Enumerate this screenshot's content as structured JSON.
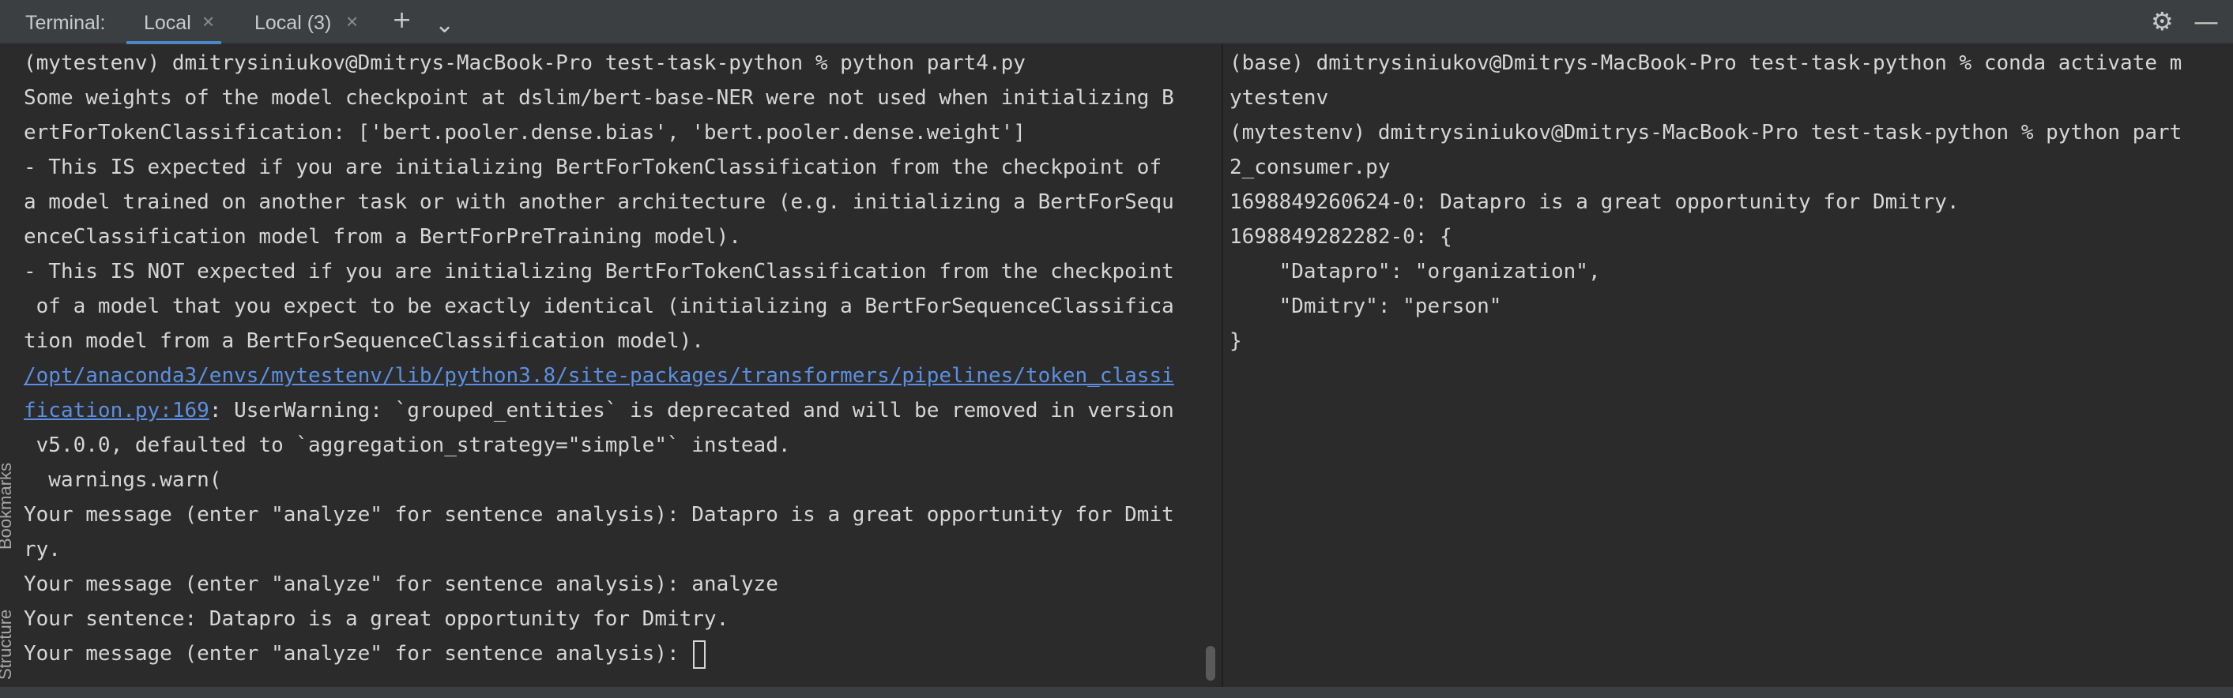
{
  "header": {
    "title": "Terminal:",
    "tabs": [
      {
        "label": "Local",
        "close": "×"
      },
      {
        "label": "Local (3)",
        "close": "×"
      }
    ],
    "add_icon": "+",
    "dropdown_icon": "⌄",
    "settings_icon": "⚙",
    "minimize_icon": "—"
  },
  "sidebar": {
    "bookmarks": "Bookmarks",
    "structure": "Structure"
  },
  "left_terminal": {
    "lines": [
      "(mytestenv) dmitrysiniukov@Dmitrys-MacBook-Pro test-task-python % python part4.py",
      "Some weights of the model checkpoint at dslim/bert-base-NER were not used when initializing B",
      "ertForTokenClassification: ['bert.pooler.dense.bias', 'bert.pooler.dense.weight']",
      "- This IS expected if you are initializing BertForTokenClassification from the checkpoint of",
      "a model trained on another task or with another architecture (e.g. initializing a BertForSequ",
      "enceClassification model from a BertForPreTraining model).",
      "- This IS NOT expected if you are initializing BertForTokenClassification from the checkpoint",
      " of a model that you expect to be exactly identical (initializing a BertForSequenceClassifica",
      "tion model from a BertForSequenceClassification model)."
    ],
    "link_line1": "/opt/anaconda3/envs/mytestenv/lib/python3.8/site-packages/transformers/pipelines/token_classi",
    "link_line2": "fication.py:169",
    "warning_rest": ": UserWarning: `grouped_entities` is deprecated and will be removed in version",
    "lines_after": [
      " v5.0.0, defaulted to `aggregation_strategy=\"simple\"` instead.",
      "  warnings.warn(",
      "Your message (enter \"analyze\" for sentence analysis): Datapro is a great opportunity for Dmit",
      "ry.",
      "Your message (enter \"analyze\" for sentence analysis): analyze",
      "Your sentence: Datapro is a great opportunity for Dmitry."
    ],
    "prompt": "Your message (enter \"analyze\" for sentence analysis): "
  },
  "right_terminal": {
    "lines": [
      "(base) dmitrysiniukov@Dmitrys-MacBook-Pro test-task-python % conda activate m",
      "ytestenv",
      "(mytestenv) dmitrysiniukov@Dmitrys-MacBook-Pro test-task-python % python part",
      "2_consumer.py",
      "1698849260624-0: Datapro is a great opportunity for Dmitry.",
      "1698849282282-0: {",
      "    \"Datapro\": \"organization\",",
      "    \"Dmitry\": \"person\"",
      "}"
    ]
  }
}
